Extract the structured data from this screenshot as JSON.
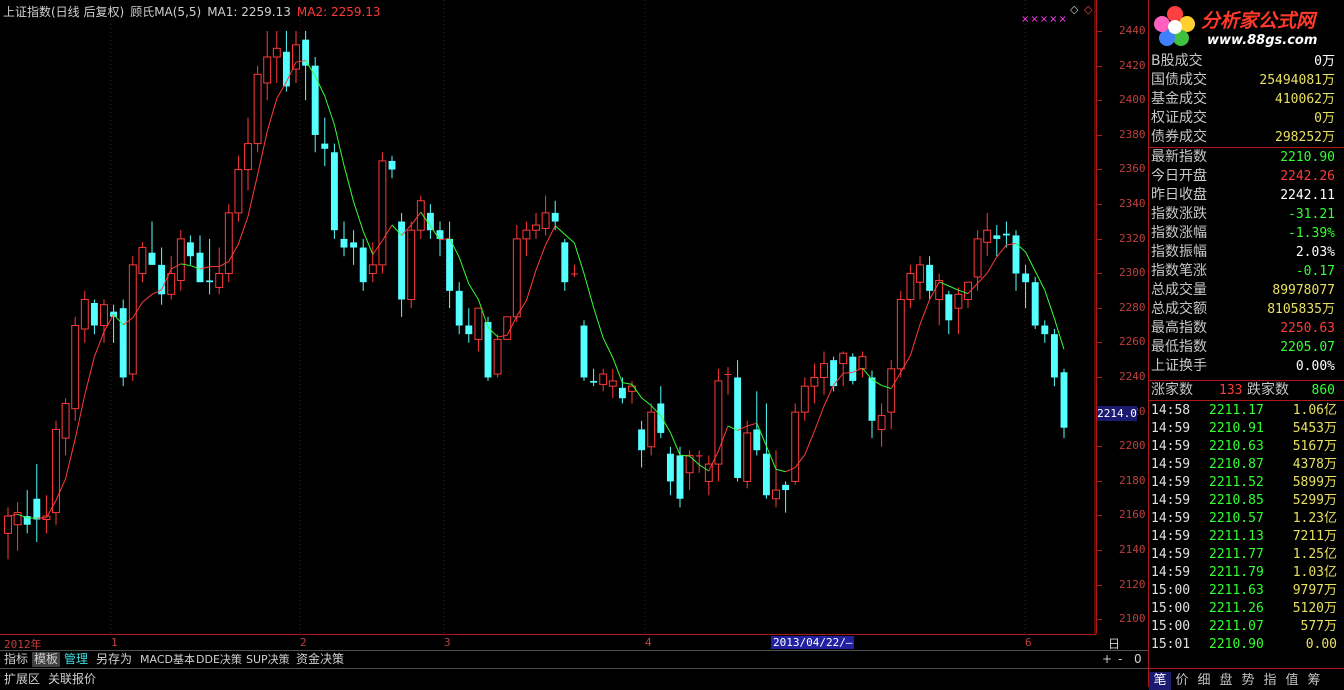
{
  "header": {
    "title": "上证指数(日线 后复权)",
    "indicator": "顾氏MA(5,5)",
    "ma1_label": "MA1: 2259.13",
    "ma2_label": "MA2: 2259.13",
    "marks": "×××××"
  },
  "colors": {
    "up": "#ff3a3a",
    "down": "#54ffff",
    "ma1": "#33ff33",
    "ma2": "#ff3a3a",
    "grid": "#b01818"
  },
  "price_axis": {
    "ticks": [
      "2440",
      "2420",
      "2400",
      "2380",
      "2360",
      "2340",
      "2320",
      "2300",
      "2280",
      "2260",
      "2240",
      "2220",
      "2200",
      "2180",
      "2160",
      "2140",
      "2120",
      "2100"
    ],
    "current_label": "2214.0"
  },
  "time_axis": {
    "labels": [
      "2012年",
      "1",
      "2",
      "3",
      "4",
      "5",
      "6"
    ],
    "cursor_date": "2013/04/22/—",
    "period": "日线"
  },
  "chart_data": {
    "type": "candlestick",
    "ylim": [
      2100,
      2440
    ],
    "candles": [
      [
        2150,
        2165,
        2135,
        2160
      ],
      [
        2155,
        2168,
        2140,
        2162
      ],
      [
        2160,
        2175,
        2150,
        2155
      ],
      [
        2170,
        2190,
        2145,
        2158
      ],
      [
        2158,
        2172,
        2150,
        2160
      ],
      [
        2162,
        2215,
        2155,
        2210
      ],
      [
        2205,
        2228,
        2195,
        2225
      ],
      [
        2222,
        2275,
        2215,
        2270
      ],
      [
        2268,
        2290,
        2260,
        2285
      ],
      [
        2283,
        2285,
        2265,
        2270
      ],
      [
        2270,
        2285,
        2260,
        2282
      ],
      [
        2278,
        2282,
        2260,
        2275
      ],
      [
        2280,
        2285,
        2235,
        2240
      ],
      [
        2242,
        2310,
        2238,
        2305
      ],
      [
        2300,
        2318,
        2295,
        2315
      ],
      [
        2312,
        2330,
        2305,
        2305
      ],
      [
        2305,
        2315,
        2282,
        2288
      ],
      [
        2288,
        2310,
        2285,
        2300
      ],
      [
        2296,
        2325,
        2290,
        2320
      ],
      [
        2318,
        2322,
        2305,
        2310
      ],
      [
        2312,
        2322,
        2295,
        2295
      ],
      [
        2296,
        2320,
        2288,
        2295
      ],
      [
        2292,
        2315,
        2288,
        2300
      ],
      [
        2300,
        2340,
        2295,
        2335
      ],
      [
        2335,
        2368,
        2330,
        2360
      ],
      [
        2360,
        2390,
        2348,
        2375
      ],
      [
        2375,
        2420,
        2370,
        2415
      ],
      [
        2410,
        2440,
        2400,
        2425
      ],
      [
        2425,
        2440,
        2410,
        2430
      ],
      [
        2428,
        2440,
        2405,
        2408
      ],
      [
        2418,
        2440,
        2410,
        2432
      ],
      [
        2435,
        2440,
        2400,
        2420
      ],
      [
        2420,
        2425,
        2370,
        2380
      ],
      [
        2375,
        2390,
        2362,
        2372
      ],
      [
        2370,
        2375,
        2320,
        2325
      ],
      [
        2320,
        2330,
        2310,
        2315
      ],
      [
        2318,
        2325,
        2305,
        2315
      ],
      [
        2315,
        2320,
        2290,
        2295
      ],
      [
        2300,
        2318,
        2295,
        2305
      ],
      [
        2305,
        2370,
        2300,
        2365
      ],
      [
        2365,
        2368,
        2355,
        2360
      ],
      [
        2330,
        2335,
        2275,
        2285
      ],
      [
        2285,
        2330,
        2280,
        2325
      ],
      [
        2325,
        2345,
        2320,
        2342
      ],
      [
        2335,
        2340,
        2320,
        2325
      ],
      [
        2325,
        2330,
        2310,
        2320
      ],
      [
        2320,
        2330,
        2280,
        2290
      ],
      [
        2290,
        2295,
        2265,
        2270
      ],
      [
        2270,
        2280,
        2260,
        2265
      ],
      [
        2262,
        2280,
        2255,
        2280
      ],
      [
        2272,
        2275,
        2238,
        2240
      ],
      [
        2242,
        2265,
        2240,
        2262
      ],
      [
        2262,
        2275,
        2262,
        2275
      ],
      [
        2275,
        2328,
        2272,
        2320
      ],
      [
        2320,
        2330,
        2310,
        2325
      ],
      [
        2325,
        2335,
        2320,
        2328
      ],
      [
        2326,
        2345,
        2322,
        2335
      ],
      [
        2335,
        2342,
        2325,
        2330
      ],
      [
        2318,
        2320,
        2290,
        2295
      ],
      [
        2300,
        2305,
        2298,
        2300
      ],
      [
        2270,
        2273,
        2238,
        2240
      ],
      [
        2238,
        2245,
        2235,
        2237
      ],
      [
        2236,
        2245,
        2232,
        2242
      ],
      [
        2235,
        2245,
        2228,
        2238
      ],
      [
        2234,
        2240,
        2225,
        2228
      ],
      [
        2232,
        2238,
        2225,
        2235
      ],
      [
        2210,
        2215,
        2188,
        2198
      ],
      [
        2200,
        2225,
        2195,
        2220
      ],
      [
        2225,
        2235,
        2205,
        2208
      ],
      [
        2196,
        2200,
        2172,
        2180
      ],
      [
        2195,
        2200,
        2165,
        2170
      ],
      [
        2185,
        2198,
        2175,
        2195
      ],
      [
        2195,
        2198,
        2185,
        2195
      ],
      [
        2180,
        2195,
        2172,
        2190
      ],
      [
        2190,
        2245,
        2180,
        2238
      ],
      [
        2242,
        2246,
        2230,
        2242
      ],
      [
        2240,
        2250,
        2180,
        2182
      ],
      [
        2180,
        2215,
        2176,
        2208
      ],
      [
        2210,
        2232,
        2195,
        2198
      ],
      [
        2196,
        2225,
        2170,
        2172
      ],
      [
        2170,
        2198,
        2165,
        2175
      ],
      [
        2178,
        2180,
        2162,
        2175
      ],
      [
        2180,
        2225,
        2178,
        2220
      ],
      [
        2220,
        2240,
        2215,
        2235
      ],
      [
        2235,
        2248,
        2225,
        2240
      ],
      [
        2240,
        2255,
        2230,
        2248
      ],
      [
        2250,
        2252,
        2232,
        2235
      ],
      [
        2248,
        2255,
        2235,
        2254
      ],
      [
        2252,
        2254,
        2236,
        2238
      ],
      [
        2245,
        2255,
        2240,
        2252
      ],
      [
        2240,
        2244,
        2205,
        2215
      ],
      [
        2210,
        2225,
        2200,
        2218
      ],
      [
        2220,
        2250,
        2210,
        2245
      ],
      [
        2245,
        2290,
        2240,
        2285
      ],
      [
        2285,
        2305,
        2280,
        2300
      ],
      [
        2295,
        2310,
        2285,
        2305
      ],
      [
        2305,
        2310,
        2285,
        2290
      ],
      [
        2285,
        2300,
        2270,
        2296
      ],
      [
        2288,
        2290,
        2265,
        2273
      ],
      [
        2280,
        2292,
        2265,
        2288
      ],
      [
        2285,
        2295,
        2280,
        2295
      ],
      [
        2298,
        2325,
        2290,
        2320
      ],
      [
        2318,
        2335,
        2310,
        2325
      ],
      [
        2322,
        2328,
        2310,
        2320
      ],
      [
        2323,
        2330,
        2315,
        2322
      ],
      [
        2322,
        2325,
        2290,
        2300
      ],
      [
        2300,
        2305,
        2280,
        2295
      ],
      [
        2295,
        2298,
        2268,
        2270
      ],
      [
        2270,
        2273,
        2260,
        2265
      ],
      [
        2265,
        2268,
        2235,
        2240
      ],
      [
        2243,
        2245,
        2205,
        2211
      ]
    ]
  },
  "panel": {
    "stats_top": [
      {
        "label": "B股成交",
        "value": "0万",
        "color": "#ffffff"
      },
      {
        "label": "国债成交",
        "value": "25494081万",
        "color": "#e8e060"
      },
      {
        "label": "基金成交",
        "value": "410062万",
        "color": "#e8e060"
      },
      {
        "label": "权证成交",
        "value": "0万",
        "color": "#e8e060"
      },
      {
        "label": "债券成交",
        "value": "298252万",
        "color": "#e8e060"
      }
    ],
    "stats": [
      {
        "label": "最新指数",
        "value": "2210.90",
        "color": "#33ff33"
      },
      {
        "label": "今日开盘",
        "value": "2242.26",
        "color": "#ff3a3a"
      },
      {
        "label": "昨日收盘",
        "value": "2242.11",
        "color": "#ffffff"
      },
      {
        "label": "指数涨跌",
        "value": "-31.21",
        "color": "#33ff33"
      },
      {
        "label": "指数涨幅",
        "value": "-1.39%",
        "color": "#33ff33"
      },
      {
        "label": "指数振幅",
        "value": "2.03%",
        "color": "#ffffff"
      },
      {
        "label": "指数笔涨",
        "value": "-0.17",
        "color": "#33ff33"
      },
      {
        "label": "总成交量",
        "value": "89978077",
        "color": "#e8e060"
      },
      {
        "label": "总成交额",
        "value": "8105835万",
        "color": "#e8e060"
      },
      {
        "label": "最高指数",
        "value": "2250.63",
        "color": "#ff3a3a"
      },
      {
        "label": "最低指数",
        "value": "2205.07",
        "color": "#33ff33"
      },
      {
        "label": "上证换手",
        "value": "0.00%",
        "color": "#ffffff"
      }
    ],
    "breadth": {
      "up_label": "涨家数",
      "up_value": "133",
      "down_label": "跌家数",
      "down_value": "860"
    },
    "ticks": [
      {
        "time": "14:58",
        "price": "2211.17",
        "vol": "1.06亿"
      },
      {
        "time": "14:59",
        "price": "2210.91",
        "vol": "5453万"
      },
      {
        "time": "14:59",
        "price": "2210.63",
        "vol": "5167万"
      },
      {
        "time": "14:59",
        "price": "2210.87",
        "vol": "4378万"
      },
      {
        "time": "14:59",
        "price": "2211.52",
        "vol": "5899万"
      },
      {
        "time": "14:59",
        "price": "2210.85",
        "vol": "5299万"
      },
      {
        "time": "14:59",
        "price": "2210.57",
        "vol": "1.23亿"
      },
      {
        "time": "14:59",
        "price": "2211.13",
        "vol": "7211万"
      },
      {
        "time": "14:59",
        "price": "2211.77",
        "vol": "1.25亿"
      },
      {
        "time": "14:59",
        "price": "2211.79",
        "vol": "1.03亿"
      },
      {
        "time": "15:00",
        "price": "2211.63",
        "vol": "9797万"
      },
      {
        "time": "15:00",
        "price": "2211.26",
        "vol": "5120万"
      },
      {
        "time": "15:00",
        "price": "2211.07",
        "vol": "577万"
      },
      {
        "time": "15:01",
        "price": "2210.90",
        "vol": "0.00"
      }
    ],
    "bottom_tabs": [
      "笔",
      "价",
      "细",
      "盘",
      "势",
      "指",
      "值",
      "筹"
    ]
  },
  "logo": {
    "text": "分析家公式网",
    "url": "www.88gs.com"
  },
  "tabbar": {
    "items": [
      "指标",
      "模板",
      "管理",
      "另存为",
      "MACD基本",
      "DDE决策",
      "SUP决策",
      "资金决策"
    ],
    "plus": "+",
    "minus": "-",
    "zero": "0"
  },
  "statusbar": {
    "items": [
      "扩展区",
      "关联报价"
    ]
  }
}
